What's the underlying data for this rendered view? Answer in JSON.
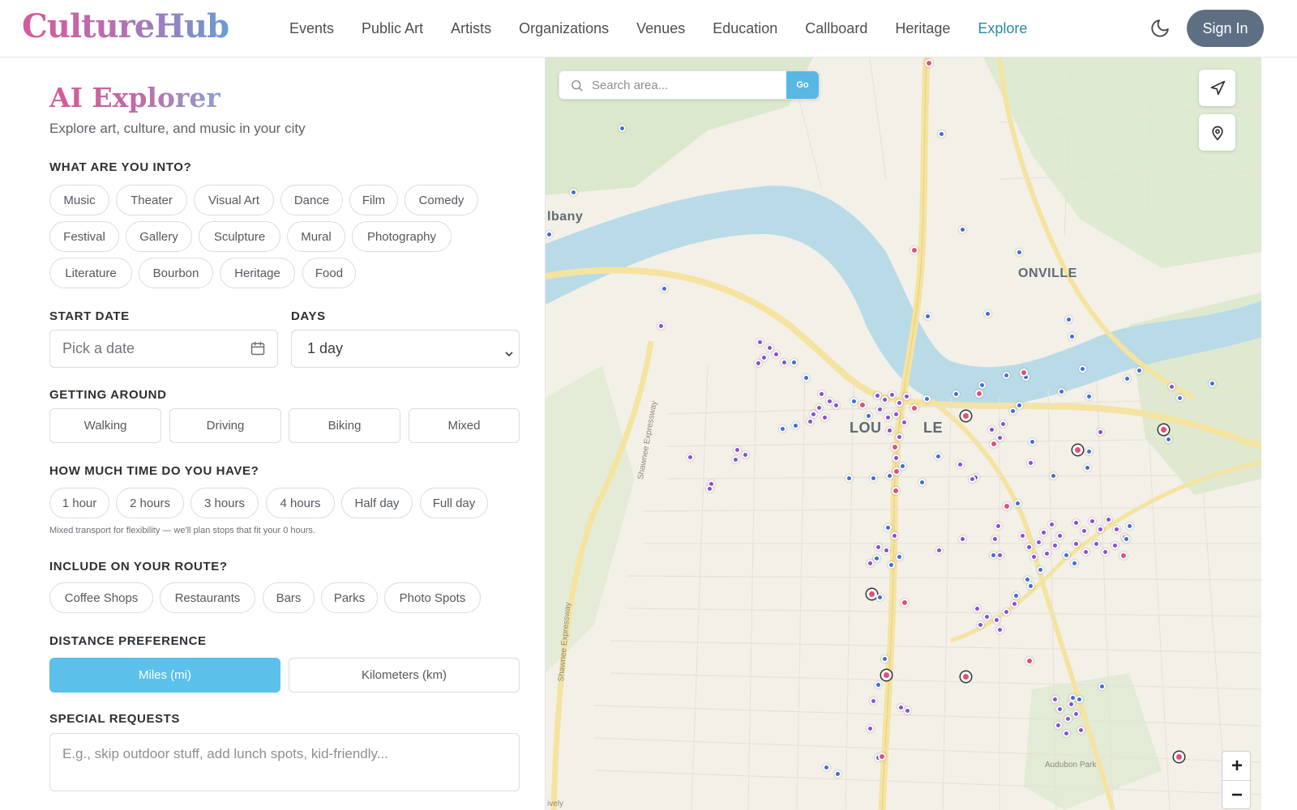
{
  "header": {
    "logo": "CultureHub",
    "nav": [
      "Events",
      "Public Art",
      "Artists",
      "Organizations",
      "Venues",
      "Education",
      "Callboard",
      "Heritage",
      "Explore"
    ],
    "active_nav": "Explore",
    "sign_in": "Sign In",
    "theme_icon": "moon-icon"
  },
  "explorer": {
    "title": "AI Explorer",
    "subtitle": "Explore art, culture, and music in your city",
    "interests": {
      "label": "WHAT ARE YOU INTO?",
      "options": [
        "Music",
        "Theater",
        "Visual Art",
        "Dance",
        "Film",
        "Comedy",
        "Festival",
        "Gallery",
        "Sculpture",
        "Mural",
        "Photography",
        "Literature",
        "Bourbon",
        "Heritage",
        "Food"
      ]
    },
    "start_date": {
      "label": "START DATE",
      "placeholder": "Pick a date"
    },
    "days": {
      "label": "DAYS",
      "value": "1 day"
    },
    "getting_around": {
      "label": "GETTING AROUND",
      "options": [
        "Walking",
        "Driving",
        "Biking",
        "Mixed"
      ]
    },
    "time": {
      "label": "HOW MUCH TIME DO YOU HAVE?",
      "options": [
        "1 hour",
        "2 hours",
        "3 hours",
        "4 hours",
        "Half day",
        "Full day"
      ],
      "note": "Mixed transport for flexibility — we'll plan stops that fit your 0 hours."
    },
    "include": {
      "label": "INCLUDE ON YOUR ROUTE?",
      "options": [
        "Coffee Shops",
        "Restaurants",
        "Bars",
        "Parks",
        "Photo Spots"
      ]
    },
    "distance": {
      "label": "DISTANCE PREFERENCE",
      "options": [
        "Miles (mi)",
        "Kilometers (km)"
      ],
      "selected": "Miles (mi)"
    },
    "special": {
      "label": "SPECIAL REQUESTS",
      "placeholder": "E.g., skip outdoor stuff, add lunch spots, kid-friendly..."
    }
  },
  "map": {
    "search_placeholder": "Search area...",
    "go": "Go",
    "labels": [
      "lbany",
      "ONVILLE",
      "LOU",
      "LE"
    ],
    "road_labels": [
      "Shawnee Expressway",
      "Shawnee Expressway",
      "Audubon Park",
      "ively"
    ],
    "zoom_in": "+",
    "zoom_out": "−",
    "colors": {
      "water": "#b9dbe8",
      "park": "#d4e6c5",
      "road": "#f7e6a8",
      "pin_blue": "#3f6fd6",
      "pin_purple": "#8a4fd3",
      "pin_pink": "#e0507a"
    }
  }
}
